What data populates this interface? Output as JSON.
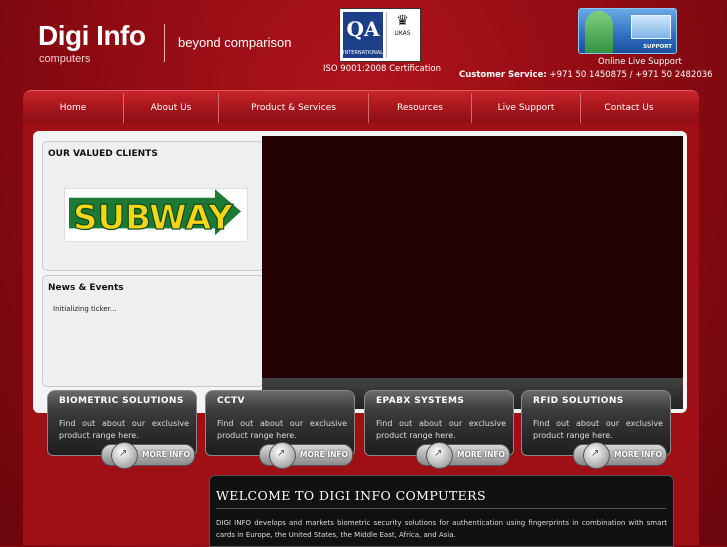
{
  "header": {
    "logo_title": "Digi Info",
    "logo_subtitle": "computers",
    "tagline": "beyond comparison",
    "cert_qa": "QA",
    "cert_qa_sub": "INTERNATIONAL",
    "cert_ukas": "UKAS",
    "iso_text": "ISO 9001:2008 Certification",
    "support_banner_label": "SUPPORT",
    "online_support": "Online Live Support",
    "customer_service_label": "Customer Service:",
    "customer_service_numbers": "+971 50  1450875 / +971 50 2482036"
  },
  "nav": {
    "items": [
      {
        "label": "Home"
      },
      {
        "label": "About Us"
      },
      {
        "label": "Product & Services"
      },
      {
        "label": "Resources"
      },
      {
        "label": "Live Support"
      },
      {
        "label": "Contact Us"
      }
    ]
  },
  "clients": {
    "title": "OUR VALUED CLIENTS",
    "logo_text": "SUBWAY"
  },
  "news": {
    "title": "News & Events",
    "ticker": "Initializing ticker..."
  },
  "products": [
    {
      "title": "BIOMETRIC SOLUTIONS",
      "desc": "Find out about our exclusive product range here.",
      "more": "MORE INFO"
    },
    {
      "title": "CCTV",
      "desc": "Find out about our exclusive product range here.",
      "more": "MORE INFO"
    },
    {
      "title": "EPABX SYSTEMS",
      "desc": "Find out about our exclusive product range here.",
      "more": "MORE INFO"
    },
    {
      "title": "RFID SOLUTIONS",
      "desc": "Find out about our exclusive product range here.",
      "more": "MORE INFO"
    }
  ],
  "welcome": {
    "title": "WELCOME TO DIGI INFO COMPUTERS",
    "text": "DIGI INFO develops and markets biometric security solutions for authentication using fingerprints in combination with smart cards in Europe, the United States, the Middle East, Africa, and Asia."
  },
  "colors": {
    "brand_red": "#a9161d",
    "subway_green": "#1c7a34",
    "subway_yellow": "#f5d517"
  }
}
